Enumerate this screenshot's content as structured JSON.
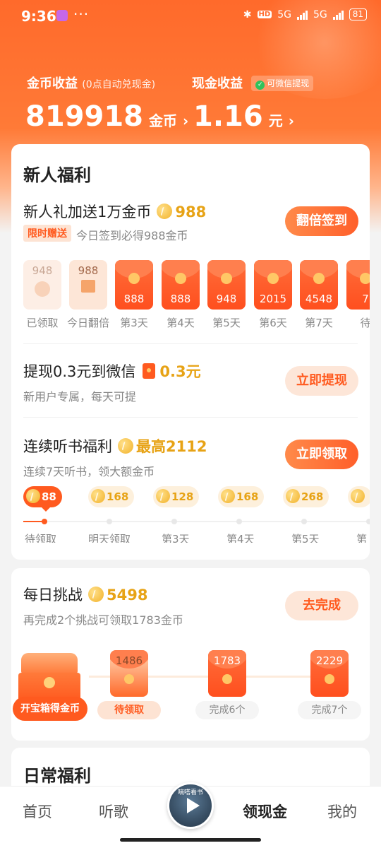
{
  "status": {
    "time": "9:36",
    "dots": "···",
    "hd": "HD",
    "net1": "5G",
    "net2": "5G",
    "battery": "81"
  },
  "earnings": {
    "coin_label": "金币收益",
    "coin_note": "(0点自动兑现金)",
    "cash_label": "现金收益",
    "wechat_tag": "可微信提现",
    "coin_value": "819918",
    "coin_unit": "金币",
    "cash_value": "1.16",
    "cash_unit": "元"
  },
  "newbie": {
    "title": "新人福利",
    "gift_title": "新人礼加送1万金币",
    "gift_amount": "988",
    "limit_tag": "限时赠送",
    "gift_sub": "今日签到必得988金币",
    "double_button": "翻倍签到",
    "days": [
      {
        "value": "948",
        "label": "已领取",
        "state": "claimed"
      },
      {
        "value": "988",
        "label": "今日翻倍",
        "state": "today"
      },
      {
        "value": "888",
        "label": "第3天",
        "state": "locked"
      },
      {
        "value": "888",
        "label": "第4天",
        "state": "locked"
      },
      {
        "value": "948",
        "label": "第5天",
        "state": "locked"
      },
      {
        "value": "2015",
        "label": "第6天",
        "state": "locked"
      },
      {
        "value": "4548",
        "label": "第7天",
        "state": "locked"
      },
      {
        "value": "7",
        "label": "待",
        "state": "locked"
      }
    ],
    "withdraw_title": "提现0.3元到微信",
    "withdraw_amount": "0.3元",
    "withdraw_sub": "新用户专属，每天可提",
    "withdraw_button": "立即提现",
    "listen_title": "连续听书福利",
    "listen_max": "最高2112",
    "listen_sub": "连续7天听书，领大额金币",
    "listen_button": "立即领取",
    "streak": [
      {
        "value": "88",
        "label": "待领取",
        "active": true
      },
      {
        "value": "168",
        "label": "明天领取",
        "active": false
      },
      {
        "value": "128",
        "label": "第3天",
        "active": false
      },
      {
        "value": "168",
        "label": "第4天",
        "active": false
      },
      {
        "value": "268",
        "label": "第5天",
        "active": false
      },
      {
        "value": "",
        "label": "第",
        "active": false
      }
    ]
  },
  "challenge": {
    "title": "每日挑战",
    "amount": "5498",
    "sub": "再完成2个挑战可领取1783金币",
    "button": "去完成",
    "chest_label": "开宝箱得金币",
    "nodes": [
      {
        "value": "1486",
        "label": "待领取"
      },
      {
        "value": "1783",
        "label": "完成6个"
      },
      {
        "value": "2229",
        "label": "完成7个"
      }
    ]
  },
  "daily": {
    "title": "日常福利"
  },
  "nav": {
    "home": "首页",
    "music": "听歌",
    "cash": "领现金",
    "mine": "我的",
    "player_text": "嘀嗒看书"
  }
}
